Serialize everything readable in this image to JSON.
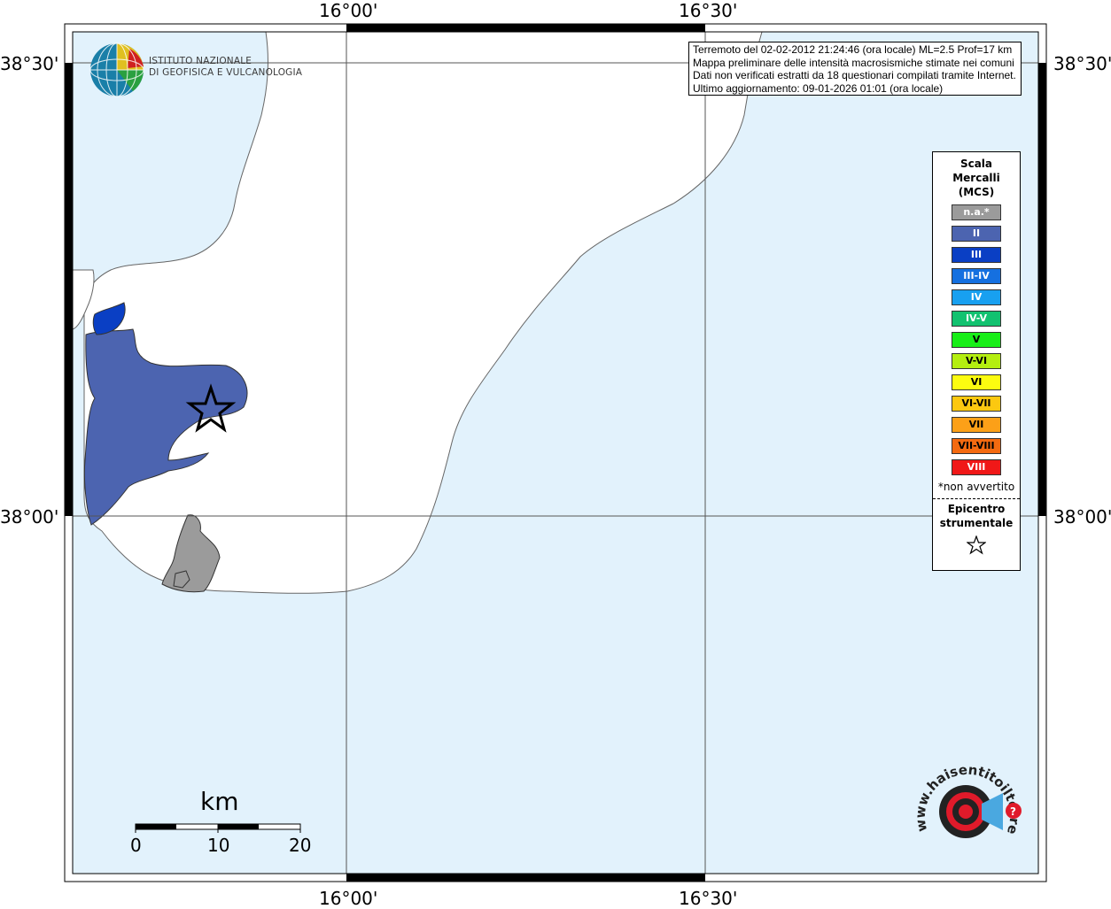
{
  "map_info": {
    "line1": "Terremoto del 02-02-2012 21:24:46 (ora locale) ML=2.5 Prof=17 km",
    "line2": "Mappa preliminare delle intensità macrosismiche stimate nei comuni",
    "line3": "Dati non verificati estratti da 18 questionari compilati tramite Internet.",
    "line4": "Ultimo aggiornamento: 09-01-2026 01:01 (ora locale)"
  },
  "coords": {
    "top_left_lon": "16°00'",
    "top_right_lon": "16°30'",
    "bottom_left_lon": "16°00'",
    "bottom_right_lon": "16°30'",
    "left_top_lat": "38°30'",
    "left_bottom_lat": "38°00'",
    "right_top_lat": "38°30'",
    "right_bottom_lat": "38°00'"
  },
  "logo": {
    "line1": "ISTITUTO NAZIONALE",
    "line2": "DI GEOFISICA E VULCANOLOGIA"
  },
  "legend": {
    "title_line1": "Scala",
    "title_line2": "Mercalli",
    "title_line3": "(MCS)",
    "items": [
      {
        "label": "n.a.*",
        "color": "#9b9b9b"
      },
      {
        "label": "II",
        "color": "#4c64b0"
      },
      {
        "label": "III",
        "color": "#0a3fc4"
      },
      {
        "label": "III-IV",
        "color": "#1570e0"
      },
      {
        "label": "IV",
        "color": "#18a0f0"
      },
      {
        "label": "IV-V",
        "color": "#12c270"
      },
      {
        "label": "V",
        "color": "#18ee18"
      },
      {
        "label": "V-VI",
        "color": "#b4ee10"
      },
      {
        "label": "VI",
        "color": "#fcfc10"
      },
      {
        "label": "VI-VII",
        "color": "#fcc810"
      },
      {
        "label": "VII",
        "color": "#fca018"
      },
      {
        "label": "VII-VIII",
        "color": "#f46a10"
      },
      {
        "label": "VIII",
        "color": "#f01818"
      }
    ],
    "note": "*non avvertito",
    "epi_line1": "Epicentro",
    "epi_line2": "strumentale"
  },
  "scale": {
    "title": "km",
    "label_0": "0",
    "label_10": "10",
    "label_20": "20"
  },
  "watermark": {
    "text": "www.haisentitoilterremoto.it"
  },
  "colors": {
    "sea": "#e2f2fc",
    "land": "#ffffff",
    "intensity_II": "#4c64b0",
    "intensity_III": "#0a3fc4",
    "not_felt": "#9b9b9b"
  }
}
